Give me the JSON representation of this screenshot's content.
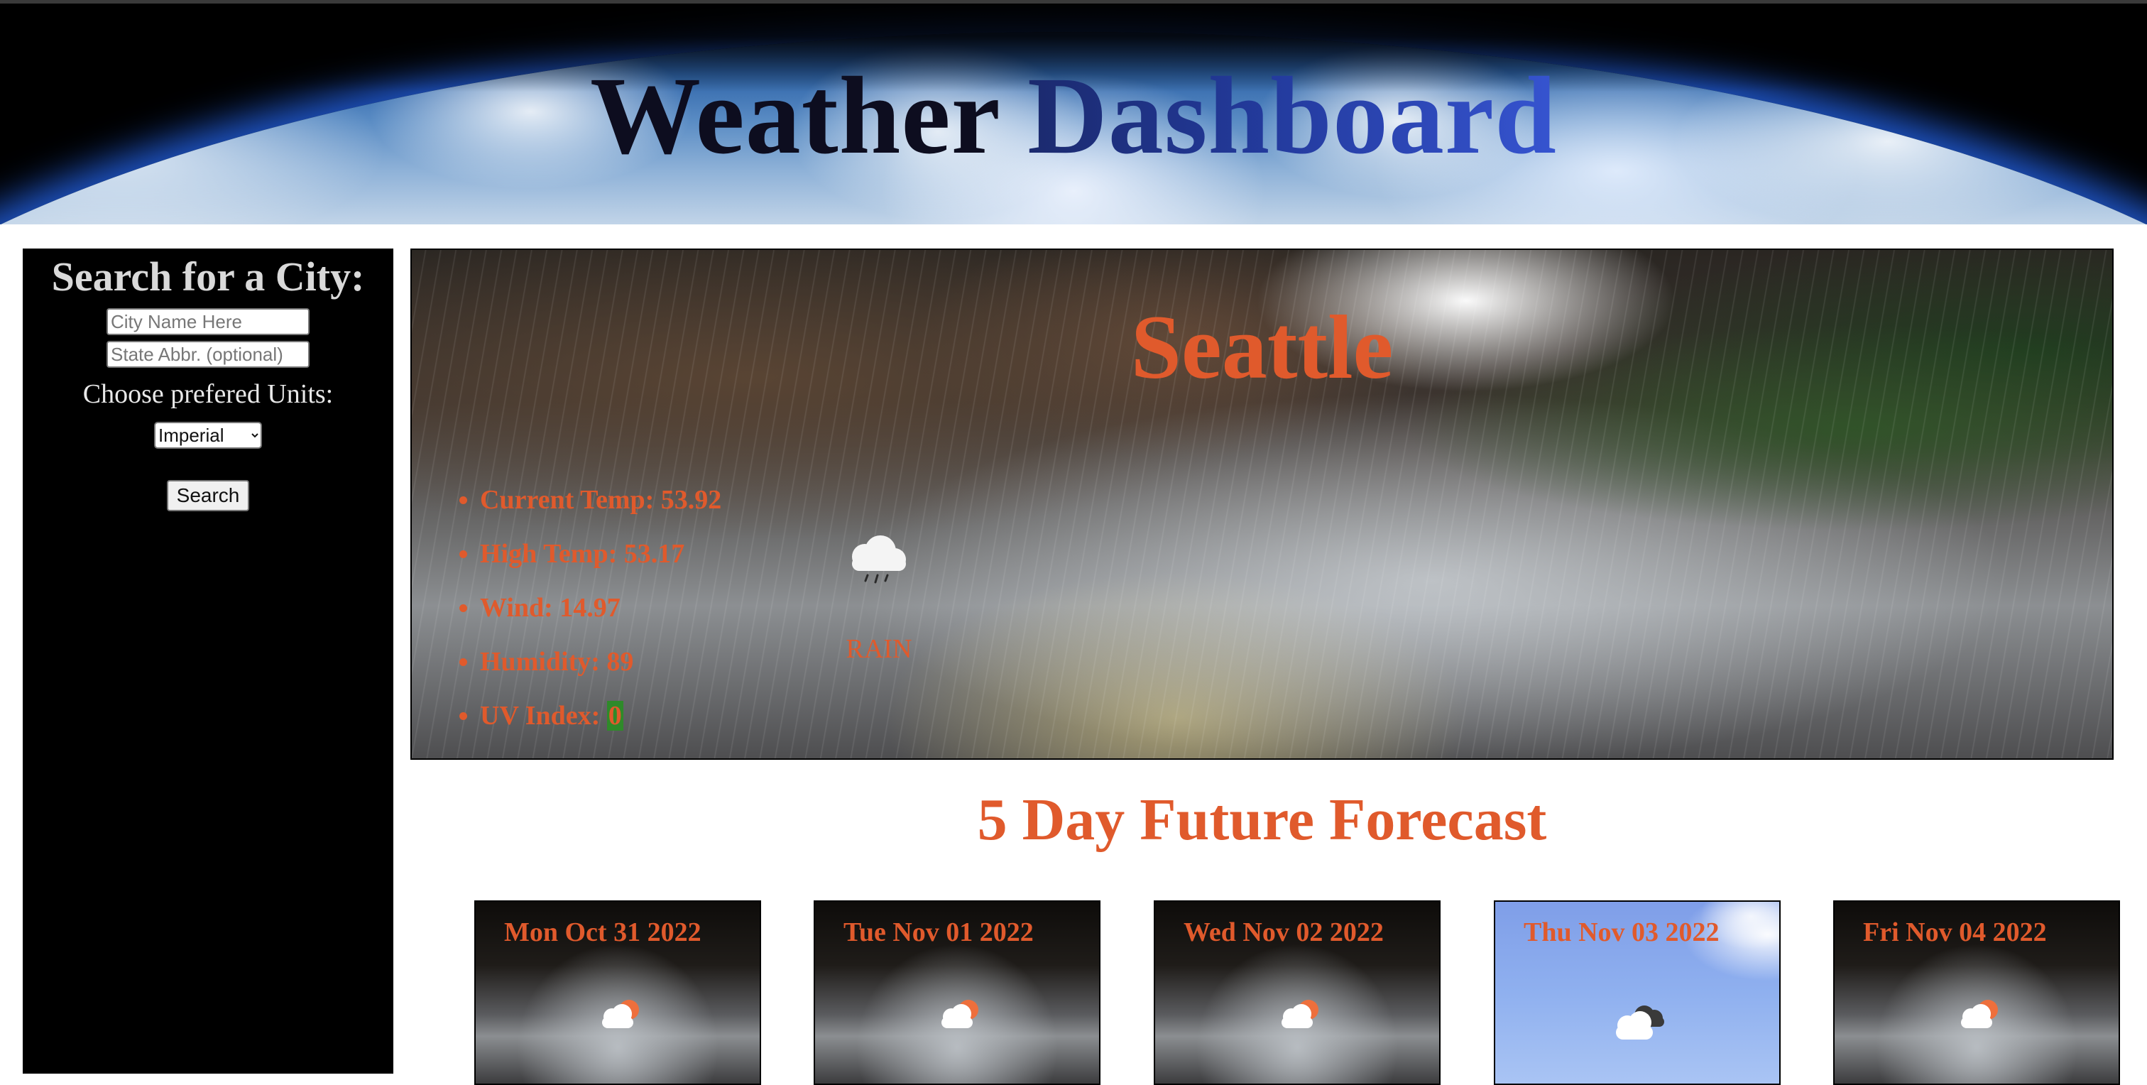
{
  "header": {
    "title_word1": "Weather",
    "title_word2": "Dashboard"
  },
  "sidebar": {
    "heading": "Search for a City:",
    "city_placeholder": "City Name Here",
    "city_value": "",
    "state_placeholder": "State Abbr. (optional)",
    "state_value": "",
    "units_label": "Choose prefered Units:",
    "units_selected": "Imperial",
    "search_button": "Search"
  },
  "current": {
    "city": "Seattle",
    "stats": [
      {
        "label": "Current Temp: ",
        "value": "53.92"
      },
      {
        "label": "High Temp: ",
        "value": "53.17"
      },
      {
        "label": "Wind: ",
        "value": "14.97"
      },
      {
        "label": "Humidity: ",
        "value": "89"
      },
      {
        "label": "UV Index: ",
        "value": "0"
      }
    ],
    "icon": "rain-cloud-icon",
    "description": "RAIN"
  },
  "forecast": {
    "title": "5 Day Future Forecast",
    "days": [
      {
        "date": "Mon Oct 31 2022",
        "icon": "partly-cloudy-icon",
        "background": "rain"
      },
      {
        "date": "Tue Nov 01 2022",
        "icon": "partly-cloudy-icon",
        "background": "rain"
      },
      {
        "date": "Wed Nov 02 2022",
        "icon": "partly-cloudy-icon",
        "background": "rain"
      },
      {
        "date": "Thu Nov 03 2022",
        "icon": "broken-clouds-icon",
        "background": "sky"
      },
      {
        "date": "Fri Nov 04 2022",
        "icon": "partly-cloudy-icon",
        "background": "rain"
      }
    ]
  },
  "colors": {
    "accent": "#e05a2c",
    "uv_badge": "#2f8a2a",
    "sidebar_bg": "#000000"
  }
}
